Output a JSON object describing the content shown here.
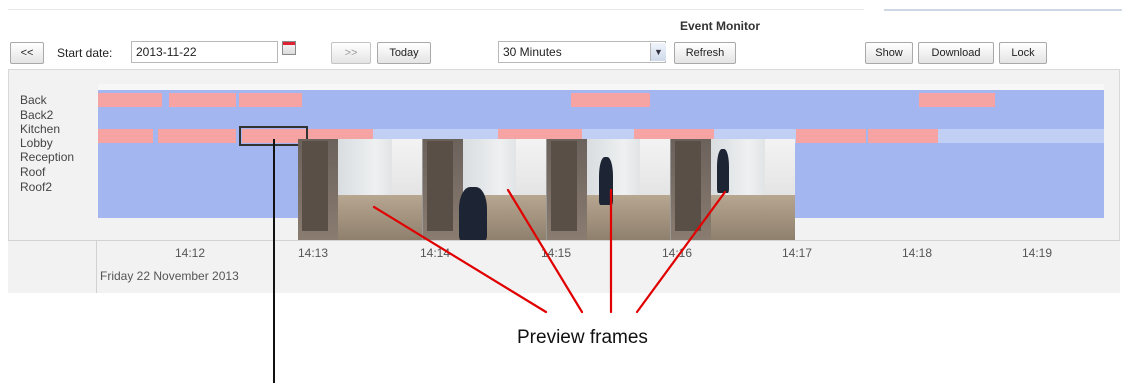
{
  "window": {
    "title": "Event Monitor"
  },
  "toolbar": {
    "prev_label": "<<",
    "start_date_label": "Start date:",
    "start_date_value": "2013-11-22",
    "next_label": ">>",
    "today_label": "Today",
    "duration_value": "30 Minutes",
    "refresh_label": "Refresh",
    "show_label": "Show",
    "download_label": "Download",
    "lock_label": "Lock"
  },
  "timeline": {
    "tracks": [
      "Back",
      "Back2",
      "Kitchen",
      "Lobby",
      "Reception",
      "Roof",
      "Roof2"
    ],
    "ticks": [
      "14:12",
      "14:13",
      "14:14",
      "14:15",
      "14:16",
      "14:17",
      "14:18",
      "14:19"
    ],
    "date": "Friday 22 November 2013",
    "colors": {
      "recording": "#a3b6ef",
      "event": "#f5a3a3",
      "selection": "#333333"
    }
  },
  "annotations": {
    "preview_frames": "Preview frames"
  }
}
